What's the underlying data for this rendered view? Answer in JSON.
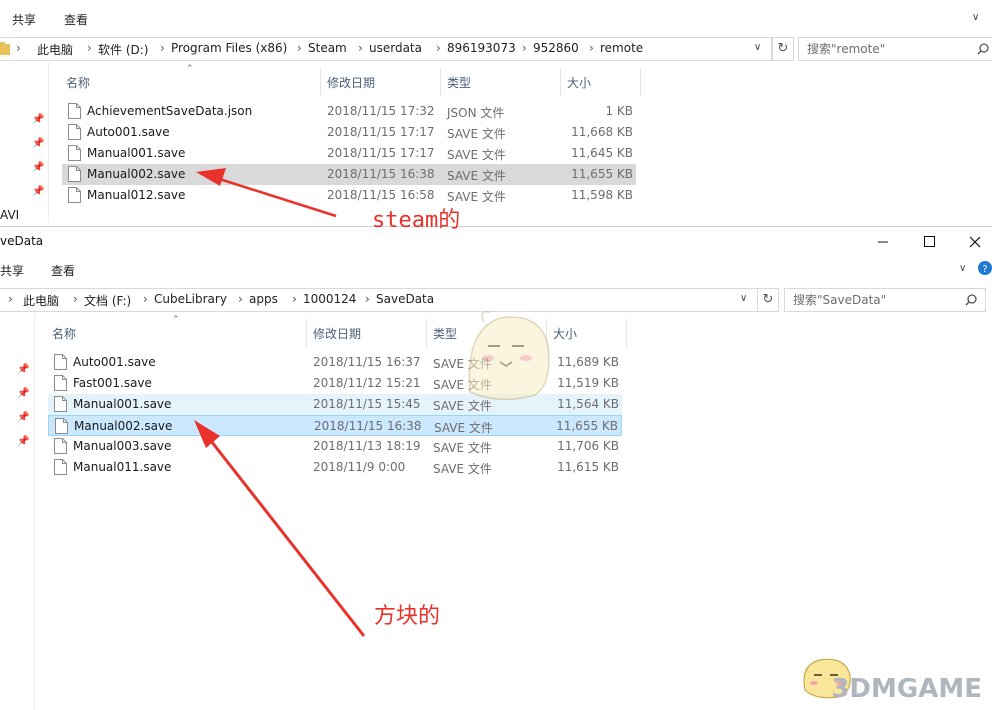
{
  "window1": {
    "ribbon_tabs": [
      "共享",
      "查看"
    ],
    "breadcrumb": [
      "此电脑",
      "软件 (D:)",
      "Program Files (x86)",
      "Steam",
      "userdata",
      "896193073",
      "952860",
      "remote"
    ],
    "search_placeholder": "搜索\"remote\"",
    "nav_fragment": "AVI",
    "columns": {
      "name": "名称",
      "date": "修改日期",
      "type": "类型",
      "size": "大小"
    },
    "files": [
      {
        "name": "AchievementSaveData.json",
        "date": "2018/11/15 17:32",
        "type": "JSON 文件",
        "size": "1 KB"
      },
      {
        "name": "Auto001.save",
        "date": "2018/11/15 17:17",
        "type": "SAVE 文件",
        "size": "11,668 KB"
      },
      {
        "name": "Manual001.save",
        "date": "2018/11/15 17:17",
        "type": "SAVE 文件",
        "size": "11,645 KB"
      },
      {
        "name": "Manual002.save",
        "date": "2018/11/15 16:38",
        "type": "SAVE 文件",
        "size": "11,655 KB"
      },
      {
        "name": "Manual012.save",
        "date": "2018/11/15 16:58",
        "type": "SAVE 文件",
        "size": "11,598 KB"
      }
    ],
    "selected_index": 3
  },
  "window2": {
    "title": "veData",
    "ribbon_tabs": [
      "共享",
      "查看"
    ],
    "breadcrumb": [
      "此电脑",
      "文档 (F:)",
      "CubeLibrary",
      "apps",
      "1000124",
      "SaveData"
    ],
    "search_placeholder": "搜索\"SaveData\"",
    "columns": {
      "name": "名称",
      "date": "修改日期",
      "type": "类型",
      "size": "大小"
    },
    "files": [
      {
        "name": "Auto001.save",
        "date": "2018/11/15 16:37",
        "type": "SAVE 文件",
        "size": "11,689 KB"
      },
      {
        "name": "Fast001.save",
        "date": "2018/11/12 15:21",
        "type": "SAVE 文件",
        "size": "11,519 KB"
      },
      {
        "name": "Manual001.save",
        "date": "2018/11/15 15:45",
        "type": "SAVE 文件",
        "size": "11,564 KB"
      },
      {
        "name": "Manual002.save",
        "date": "2018/11/15 16:38",
        "type": "SAVE 文件",
        "size": "11,655 KB"
      },
      {
        "name": "Manual003.save",
        "date": "2018/11/13 18:19",
        "type": "SAVE 文件",
        "size": "11,706 KB"
      },
      {
        "name": "Manual011.save",
        "date": "2018/11/9 0:00",
        "type": "SAVE 文件",
        "size": "11,615 KB"
      }
    ],
    "hover_index": 2,
    "selected_index": 3
  },
  "annotations": {
    "steam_label": "steam的",
    "cube_label": "方块的",
    "color": "#e8322b"
  },
  "watermark": {
    "text": "3DMGAME"
  },
  "icons": {
    "folder": "folder-icon",
    "file": "file-icon",
    "pin": "pin-icon",
    "search": "search-icon",
    "refresh": "refresh-icon",
    "help": "help-icon"
  }
}
